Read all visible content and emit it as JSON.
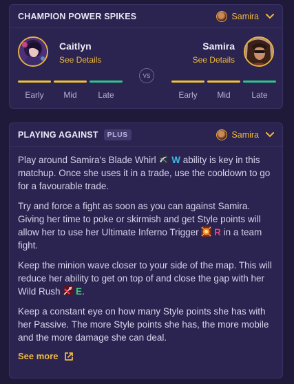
{
  "spikes_panel": {
    "title": "CHAMPION POWER SPIKES",
    "selected_champion": "Samira",
    "left": {
      "name": "Caitlyn",
      "details_label": "See Details"
    },
    "right": {
      "name": "Samira",
      "details_label": "See Details"
    },
    "vs_label": "VS",
    "phase_labels": [
      "Early",
      "Mid",
      "Late"
    ],
    "colors": {
      "early": "#f2c230",
      "mid": "#f2c230",
      "late": "#2fc58b"
    }
  },
  "against_panel": {
    "title": "PLAYING AGAINST",
    "badge": "PLUS",
    "selected_champion": "Samira",
    "para1_pre": "Play around Samira's Blade Whirl",
    "para1_key": "W",
    "para1_post": "ability is key in this matchup. Once she uses it in a trade, use the cooldown to go for a favourable trade.",
    "para2_pre": "Try and force a fight as soon as you can against Samira. Giving her time to poke or skirmish and get Style points will allow her to use her Ultimate Inferno Trigger",
    "para2_key": "R",
    "para2_post": "in a team fight.",
    "para3_pre": "Keep the minion wave closer to your side of the map. This will reduce her ability to get on top of and close the gap with her Wild Rush",
    "para3_key": "E",
    "para3_post": ".",
    "para4": "Keep a constant eye on how many Style points she has with her Passive. The more Style points she has, the more mobile and the more damage she can deal.",
    "see_more_label": "See more",
    "key_colors": {
      "W": "#3fb7e8",
      "R": "#e8457a",
      "E": "#3cd07a"
    }
  }
}
